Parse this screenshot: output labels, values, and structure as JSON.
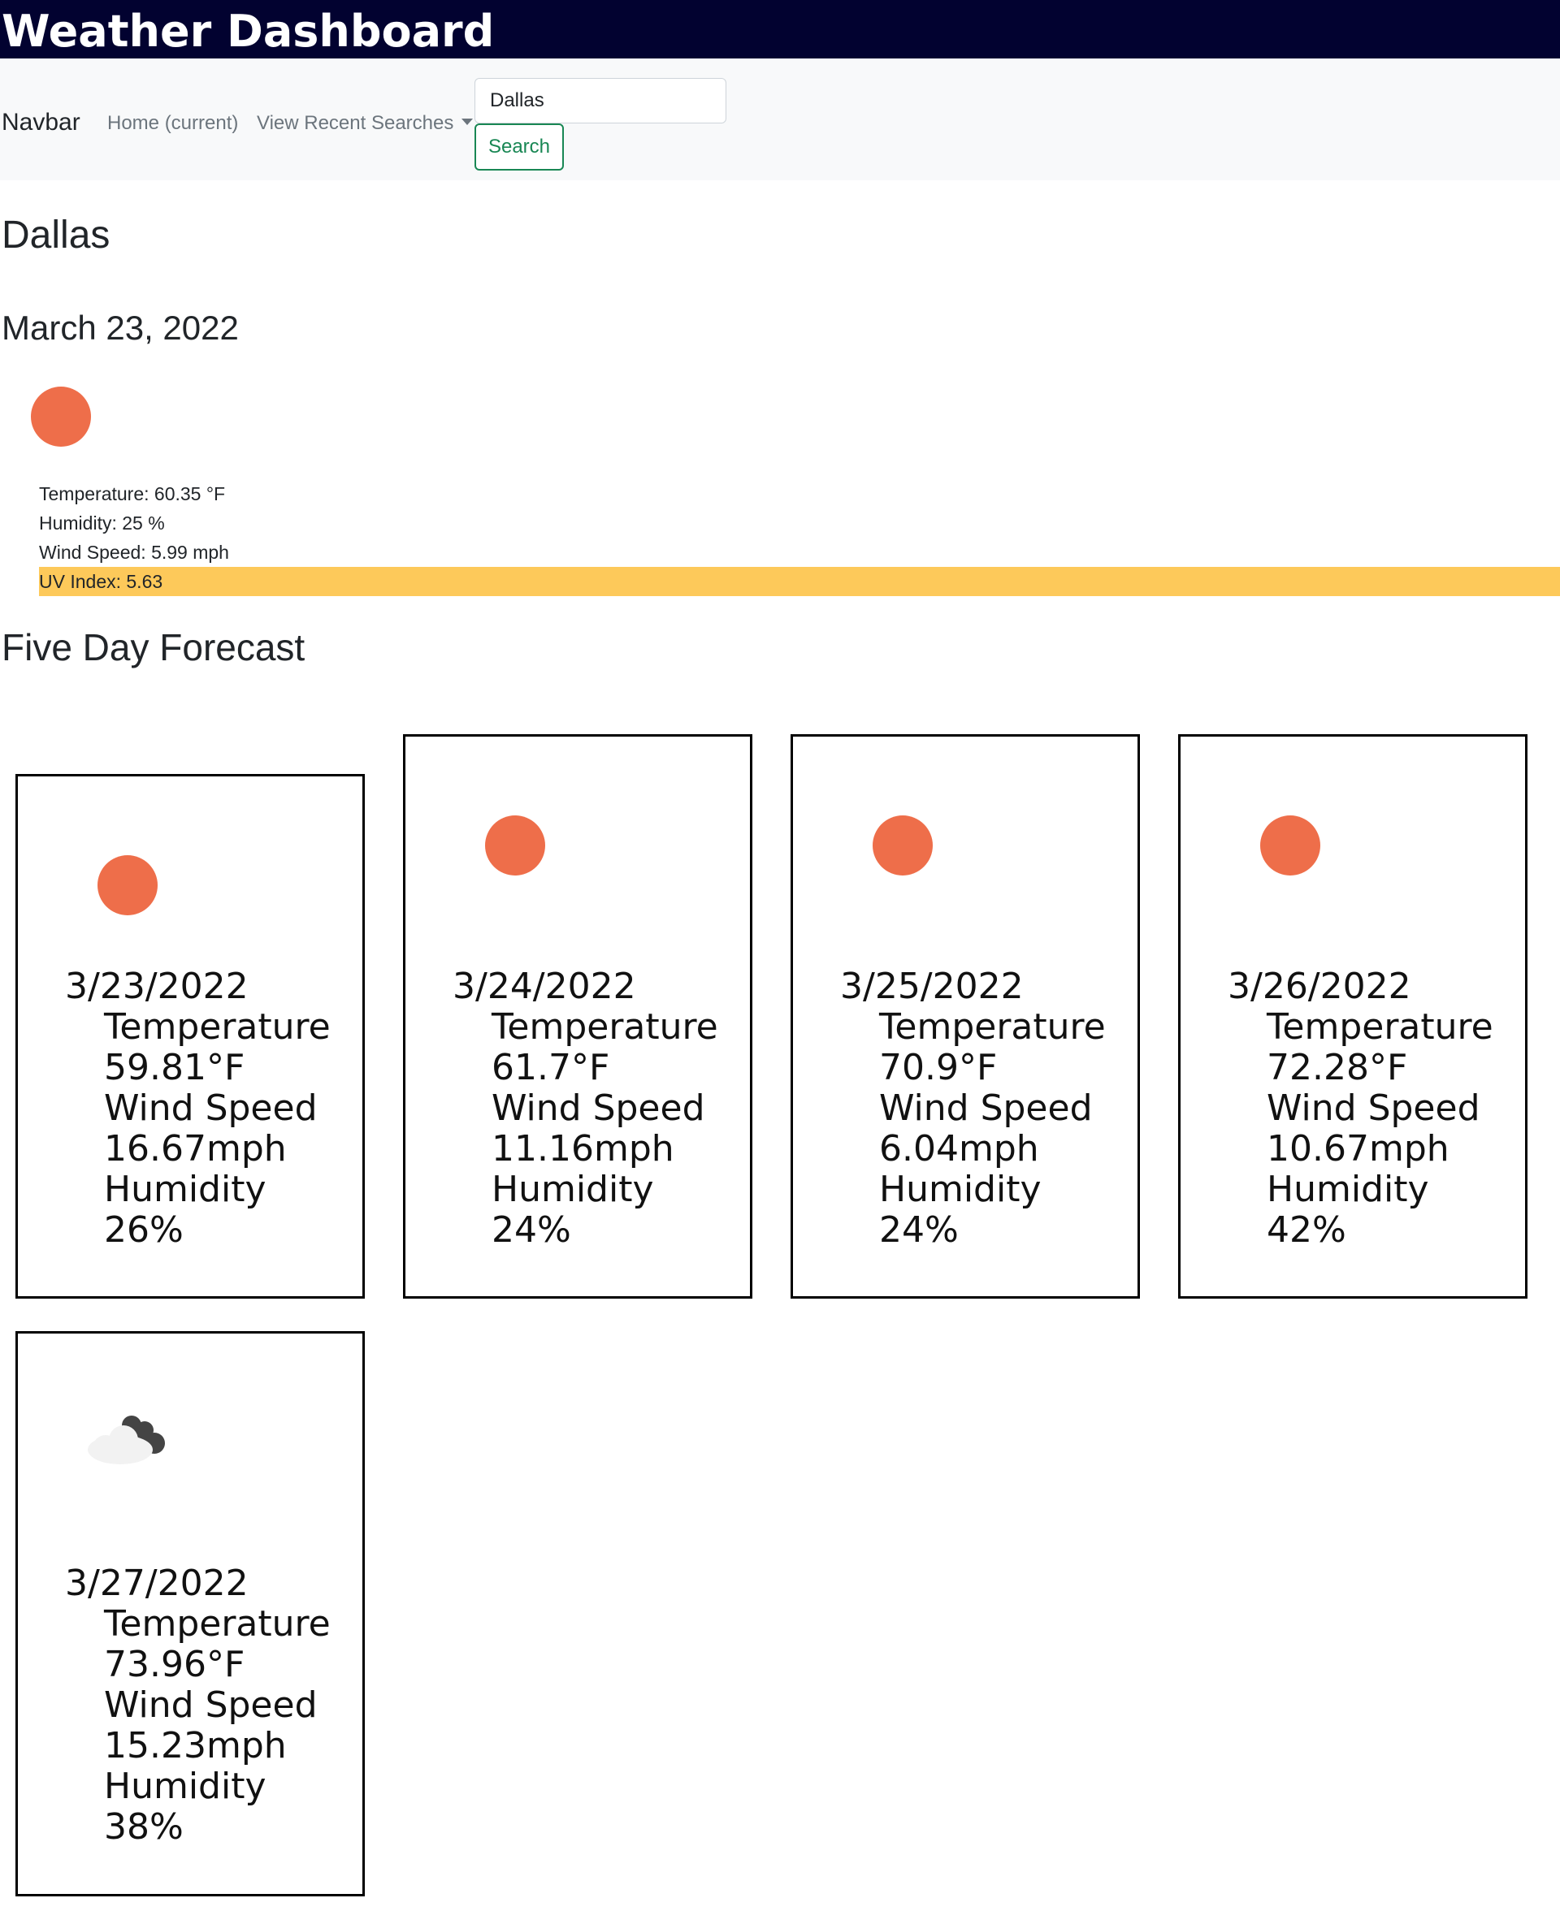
{
  "header": {
    "title": "Weather Dashboard"
  },
  "navbar": {
    "brand": "Navbar",
    "home_label": "Home (current)",
    "recent_label": "View Recent Searches",
    "search_value": "Dallas",
    "search_button": "Search"
  },
  "current": {
    "city": "Dallas",
    "date": "March 23, 2022",
    "icon": "sun-icon",
    "temperature": "Temperature: 60.35 °F",
    "humidity": "Humidity: 25 %",
    "wind": "Wind Speed: 5.99 mph",
    "uv": "UV Index: 5.63",
    "uv_color": "#fdc95a"
  },
  "forecast": {
    "heading": "Five Day Forecast",
    "days": [
      {
        "date": "3/23/2022",
        "temp_label": "Temperature",
        "temp": "59.81°F",
        "wind_label": "Wind Speed",
        "wind": "16.67mph",
        "hum_label": "Humidity",
        "hum": "26%",
        "icon": "sun-icon"
      },
      {
        "date": "3/24/2022",
        "temp_label": "Temperature",
        "temp": "61.7°F",
        "wind_label": "Wind Speed",
        "wind": "11.16mph",
        "hum_label": "Humidity",
        "hum": "24%",
        "icon": "sun-icon"
      },
      {
        "date": "3/25/2022",
        "temp_label": "Temperature",
        "temp": "70.9°F",
        "wind_label": "Wind Speed",
        "wind": "6.04mph",
        "hum_label": "Humidity",
        "hum": "24%",
        "icon": "sun-icon"
      },
      {
        "date": "3/26/2022",
        "temp_label": "Temperature",
        "temp": "72.28°F",
        "wind_label": "Wind Speed",
        "wind": "10.67mph",
        "hum_label": "Humidity",
        "hum": "42%",
        "icon": "sun-icon"
      },
      {
        "date": "3/27/2022",
        "temp_label": "Temperature",
        "temp": "73.96°F",
        "wind_label": "Wind Speed",
        "wind": "15.23mph",
        "hum_label": "Humidity",
        "hum": "38%",
        "icon": "cloud-icon"
      }
    ]
  },
  "colors": {
    "header_bg": "#020230",
    "sun": "#ee6e4a",
    "search_accent": "#198754"
  }
}
